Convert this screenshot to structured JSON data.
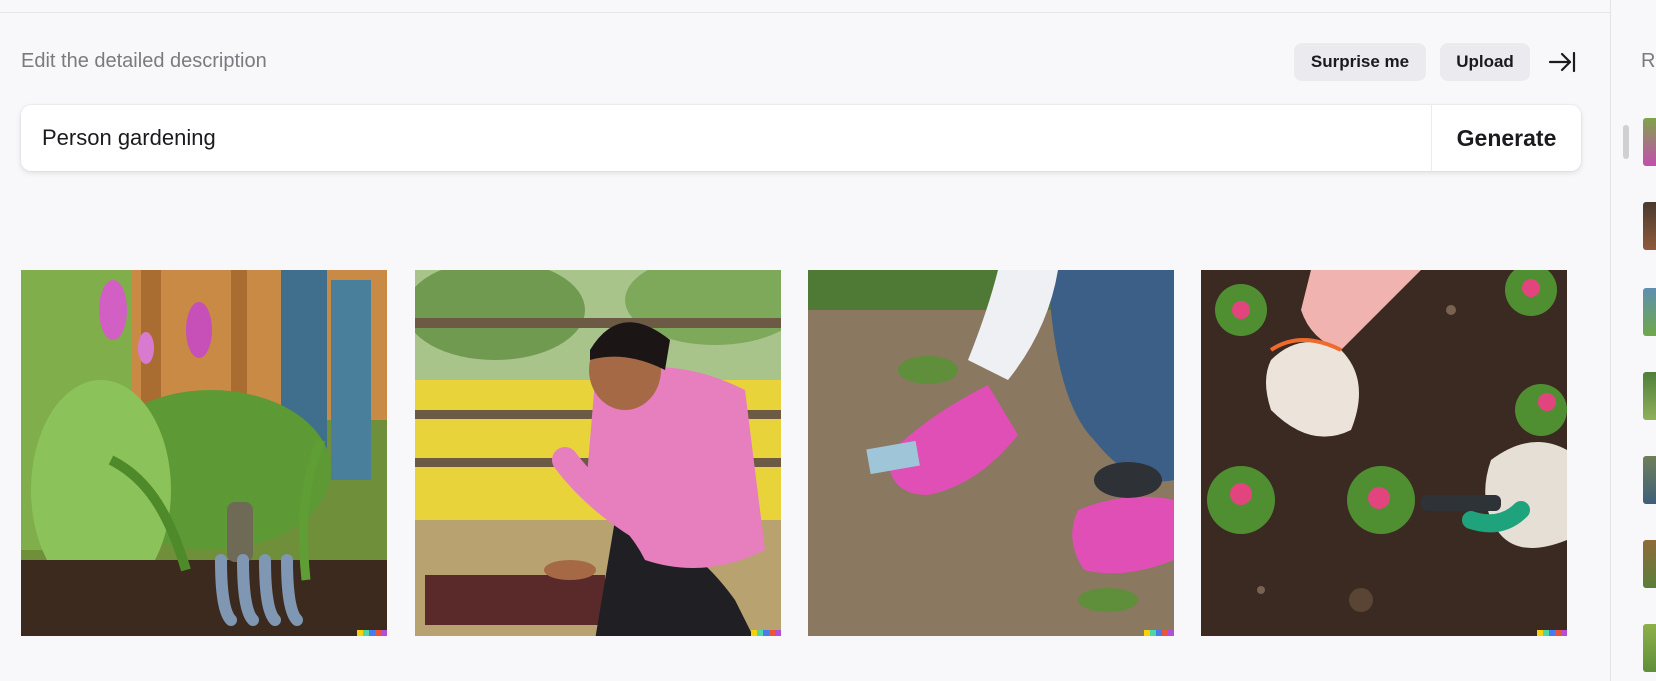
{
  "editor": {
    "label": "Edit the detailed description",
    "surprise_label": "Surprise me",
    "upload_label": "Upload",
    "prompt_value": "Person gardening",
    "generate_label": "Generate"
  },
  "results": [
    {
      "name": "result-image-1",
      "subject": "garden rake near flowers"
    },
    {
      "name": "result-image-2",
      "subject": "man in pink shirt planting"
    },
    {
      "name": "result-image-3",
      "subject": "pink gloves in soil"
    },
    {
      "name": "result-image-4",
      "subject": "gloved hands planting flowers"
    }
  ],
  "history_panel": {
    "label": "R",
    "thumbnail_count": 7
  },
  "colors": {
    "signature": [
      "#f5d20a",
      "#4fd6a5",
      "#4a7af0",
      "#e8553a",
      "#b14fd6"
    ]
  }
}
